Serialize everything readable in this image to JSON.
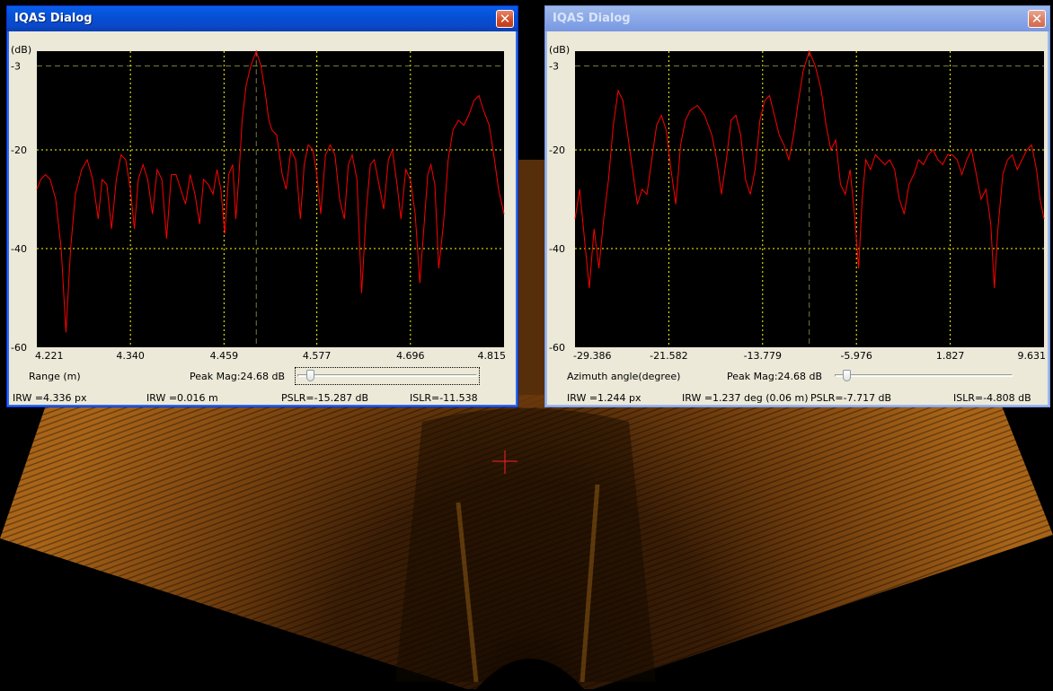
{
  "dialogs": [
    {
      "title": "IQAS Dialog",
      "active": true,
      "y_unit": "(dB)",
      "y_ticks": [
        "-3",
        "-20",
        "-40",
        "-60"
      ],
      "x_ticks": [
        "4.221",
        "4.340",
        "4.459",
        "4.577",
        "4.696",
        "4.815"
      ],
      "x_label": "Range (m)",
      "peak_mag": "Peak Mag:24.68 dB",
      "slider_value": 0.05,
      "stats": [
        "IRW =4.336 px",
        "IRW =0.016 m",
        "PSLR=-15.287 dB",
        "ISLR=-11.538"
      ]
    },
    {
      "title": "IQAS Dialog",
      "active": false,
      "y_unit": "(dB)",
      "y_ticks": [
        "-3",
        "-20",
        "-40",
        "-60"
      ],
      "x_ticks": [
        "-29.386",
        "-21.582",
        "-13.779",
        "-5.976",
        "1.827",
        "9.631"
      ],
      "x_label": "Azimuth angle(degree)",
      "peak_mag": "Peak Mag:24.68 dB",
      "slider_value": 0.05,
      "stats": [
        "IRW =1.244 px",
        "IRW =1.237 deg (0.06 m)",
        "PSLR=-7.717 dB",
        "ISLR=-4.808 dB"
      ]
    }
  ],
  "chart_data": [
    {
      "type": "line",
      "y_unit": "(dB)",
      "ylim": [
        -60,
        0
      ],
      "y_ticks": [
        -3,
        -20,
        -40,
        -60
      ],
      "xlim": [
        4.221,
        4.815
      ],
      "x_ticks": [
        4.221,
        4.34,
        4.459,
        4.577,
        4.696,
        4.815
      ],
      "xlabel": "Range (m)",
      "peak_x": 4.5,
      "series": [
        {
          "color": "#ff0000",
          "points": [
            [
              4.221,
              -28
            ],
            [
              4.226,
              -26
            ],
            [
              4.232,
              -25
            ],
            [
              4.238,
              -26
            ],
            [
              4.245,
              -30
            ],
            [
              4.252,
              -40
            ],
            [
              4.258,
              -57
            ],
            [
              4.264,
              -40
            ],
            [
              4.27,
              -29
            ],
            [
              4.278,
              -24
            ],
            [
              4.285,
              -22
            ],
            [
              4.292,
              -26
            ],
            [
              4.299,
              -34
            ],
            [
              4.304,
              -26
            ],
            [
              4.31,
              -27
            ],
            [
              4.316,
              -36
            ],
            [
              4.322,
              -26
            ],
            [
              4.328,
              -21
            ],
            [
              4.334,
              -22
            ],
            [
              4.34,
              -28
            ],
            [
              4.345,
              -36
            ],
            [
              4.35,
              -26
            ],
            [
              4.356,
              -23
            ],
            [
              4.362,
              -26
            ],
            [
              4.368,
              -33
            ],
            [
              4.374,
              -24
            ],
            [
              4.38,
              -26
            ],
            [
              4.386,
              -38
            ],
            [
              4.392,
              -25
            ],
            [
              4.398,
              -25
            ],
            [
              4.404,
              -28
            ],
            [
              4.41,
              -31
            ],
            [
              4.416,
              -25
            ],
            [
              4.422,
              -29
            ],
            [
              4.428,
              -35
            ],
            [
              4.433,
              -26
            ],
            [
              4.439,
              -27
            ],
            [
              4.445,
              -29
            ],
            [
              4.45,
              -24
            ],
            [
              4.455,
              -28
            ],
            [
              4.46,
              -37
            ],
            [
              4.465,
              -25
            ],
            [
              4.47,
              -23
            ],
            [
              4.474,
              -34
            ],
            [
              4.478,
              -25
            ],
            [
              4.482,
              -14
            ],
            [
              4.487,
              -7
            ],
            [
              4.493,
              -3
            ],
            [
              4.5,
              0
            ],
            [
              4.506,
              -3
            ],
            [
              4.511,
              -8
            ],
            [
              4.516,
              -14
            ],
            [
              4.52,
              -16
            ],
            [
              4.526,
              -17
            ],
            [
              4.533,
              -25
            ],
            [
              4.538,
              -28
            ],
            [
              4.544,
              -20
            ],
            [
              4.55,
              -22
            ],
            [
              4.556,
              -34
            ],
            [
              4.561,
              -23
            ],
            [
              4.566,
              -19
            ],
            [
              4.572,
              -20
            ],
            [
              4.577,
              -25
            ],
            [
              4.582,
              -33
            ],
            [
              4.588,
              -21
            ],
            [
              4.594,
              -19
            ],
            [
              4.6,
              -21
            ],
            [
              4.606,
              -30
            ],
            [
              4.612,
              -34
            ],
            [
              4.617,
              -23
            ],
            [
              4.622,
              -21
            ],
            [
              4.628,
              -26
            ],
            [
              4.634,
              -49
            ],
            [
              4.64,
              -32
            ],
            [
              4.645,
              -23
            ],
            [
              4.65,
              -22
            ],
            [
              4.656,
              -27
            ],
            [
              4.662,
              -32
            ],
            [
              4.668,
              -22
            ],
            [
              4.673,
              -20
            ],
            [
              4.679,
              -27
            ],
            [
              4.684,
              -34
            ],
            [
              4.69,
              -24
            ],
            [
              4.696,
              -26
            ],
            [
              4.702,
              -33
            ],
            [
              4.708,
              -47
            ],
            [
              4.713,
              -36
            ],
            [
              4.718,
              -25
            ],
            [
              4.722,
              -23
            ],
            [
              4.727,
              -27
            ],
            [
              4.732,
              -44
            ],
            [
              4.738,
              -35
            ],
            [
              4.744,
              -22
            ],
            [
              4.75,
              -16
            ],
            [
              4.757,
              -14
            ],
            [
              4.764,
              -15
            ],
            [
              4.77,
              -13
            ],
            [
              4.777,
              -10
            ],
            [
              4.783,
              -9
            ],
            [
              4.789,
              -12
            ],
            [
              4.796,
              -15
            ],
            [
              4.802,
              -21
            ],
            [
              4.808,
              -28
            ],
            [
              4.815,
              -33
            ]
          ]
        }
      ]
    },
    {
      "type": "line",
      "y_unit": "(dB)",
      "ylim": [
        -60,
        0
      ],
      "y_ticks": [
        -3,
        -20,
        -40,
        -60
      ],
      "xlim": [
        -29.386,
        9.631
      ],
      "x_ticks": [
        -29.386,
        -21.582,
        -13.779,
        -5.976,
        1.827,
        9.631
      ],
      "xlabel": "Azimuth angle(degree)",
      "peak_x": -9.9,
      "series": [
        {
          "color": "#ff0000",
          "points": [
            [
              -29.386,
              -34
            ],
            [
              -29.0,
              -28
            ],
            [
              -28.6,
              -38
            ],
            [
              -28.2,
              -48
            ],
            [
              -27.8,
              -36
            ],
            [
              -27.4,
              -44
            ],
            [
              -27.0,
              -34
            ],
            [
              -26.6,
              -26
            ],
            [
              -26.2,
              -15
            ],
            [
              -25.8,
              -8
            ],
            [
              -25.4,
              -10
            ],
            [
              -25.0,
              -17
            ],
            [
              -24.6,
              -24
            ],
            [
              -24.2,
              -31
            ],
            [
              -23.8,
              -28
            ],
            [
              -23.4,
              -29
            ],
            [
              -23.0,
              -22
            ],
            [
              -22.6,
              -15
            ],
            [
              -22.2,
              -13
            ],
            [
              -21.8,
              -16
            ],
            [
              -21.4,
              -24
            ],
            [
              -21.0,
              -31
            ],
            [
              -20.6,
              -19
            ],
            [
              -20.2,
              -14
            ],
            [
              -19.8,
              -12
            ],
            [
              -19.2,
              -11
            ],
            [
              -18.6,
              -13
            ],
            [
              -18.0,
              -17
            ],
            [
              -17.6,
              -22
            ],
            [
              -17.2,
              -29
            ],
            [
              -16.8,
              -22
            ],
            [
              -16.4,
              -14
            ],
            [
              -16.0,
              -13
            ],
            [
              -15.6,
              -17
            ],
            [
              -15.2,
              -26
            ],
            [
              -14.8,
              -29
            ],
            [
              -14.4,
              -24
            ],
            [
              -14.0,
              -14
            ],
            [
              -13.6,
              -10
            ],
            [
              -13.2,
              -9
            ],
            [
              -12.8,
              -13
            ],
            [
              -12.4,
              -17
            ],
            [
              -12.0,
              -19
            ],
            [
              -11.6,
              -22
            ],
            [
              -11.2,
              -17
            ],
            [
              -10.8,
              -10
            ],
            [
              -10.4,
              -4
            ],
            [
              -9.9,
              0
            ],
            [
              -9.4,
              -3
            ],
            [
              -8.9,
              -8
            ],
            [
              -8.5,
              -15
            ],
            [
              -8.1,
              -20
            ],
            [
              -7.7,
              -18
            ],
            [
              -7.3,
              -27
            ],
            [
              -6.9,
              -29
            ],
            [
              -6.5,
              -24
            ],
            [
              -6.1,
              -34
            ],
            [
              -5.8,
              -44
            ],
            [
              -5.5,
              -30
            ],
            [
              -5.2,
              -22
            ],
            [
              -4.8,
              -24
            ],
            [
              -4.4,
              -21
            ],
            [
              -4.0,
              -22
            ],
            [
              -3.6,
              -23
            ],
            [
              -3.2,
              -22
            ],
            [
              -2.8,
              -24
            ],
            [
              -2.4,
              -30
            ],
            [
              -2.0,
              -33
            ],
            [
              -1.6,
              -27
            ],
            [
              -1.2,
              -25
            ],
            [
              -0.8,
              -22
            ],
            [
              -0.4,
              -23
            ],
            [
              0.0,
              -21
            ],
            [
              0.4,
              -20
            ],
            [
              0.8,
              -22
            ],
            [
              1.2,
              -23
            ],
            [
              1.6,
              -21
            ],
            [
              2.0,
              -21
            ],
            [
              2.4,
              -22
            ],
            [
              2.8,
              -25
            ],
            [
              3.2,
              -22
            ],
            [
              3.6,
              -20
            ],
            [
              4.0,
              -25
            ],
            [
              4.4,
              -30
            ],
            [
              4.8,
              -28
            ],
            [
              5.2,
              -35
            ],
            [
              5.5,
              -48
            ],
            [
              5.8,
              -36
            ],
            [
              6.2,
              -25
            ],
            [
              6.6,
              -22
            ],
            [
              7.0,
              -21
            ],
            [
              7.4,
              -24
            ],
            [
              7.8,
              -22
            ],
            [
              8.2,
              -20
            ],
            [
              8.6,
              -19
            ],
            [
              9.0,
              -24
            ],
            [
              9.3,
              -30
            ],
            [
              9.631,
              -34
            ]
          ]
        }
      ]
    }
  ]
}
